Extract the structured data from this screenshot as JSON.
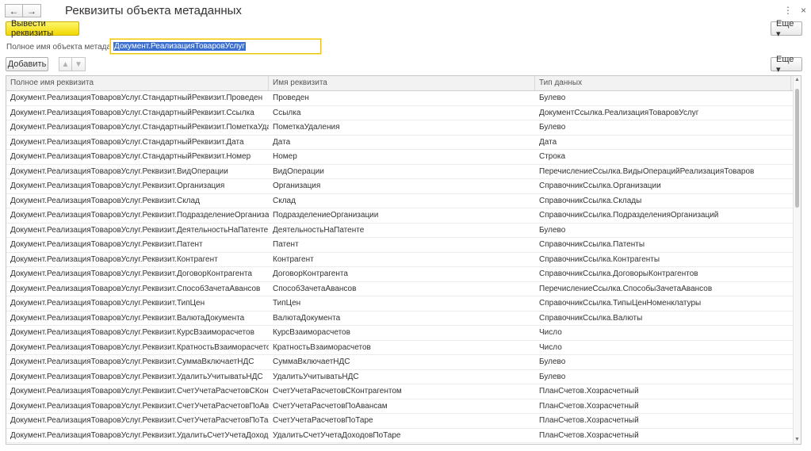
{
  "window": {
    "title": "Реквизиты объекта метаданных",
    "back_icon": "←",
    "forward_icon": "→",
    "more_icon": "⋮",
    "close_icon": "×"
  },
  "toolbar": {
    "print_button": "Вывести реквизиты",
    "more_button": "Еще ▾"
  },
  "field": {
    "label": "Полное имя объекта метаданных:",
    "value": "Документ.РеализацияТоваровУслуг"
  },
  "table_toolbar": {
    "add_button": "Добавить",
    "up_icon": "▲",
    "down_icon": "▼",
    "more_button": "Еще ▾"
  },
  "table": {
    "columns": [
      "Полное имя реквизита",
      "Имя реквизита",
      "Тип данных"
    ],
    "rows": [
      [
        "Документ.РеализацияТоваровУслуг.СтандартныйРеквизит.Проведен",
        "Проведен",
        "Булево"
      ],
      [
        "Документ.РеализацияТоваровУслуг.СтандартныйРеквизит.Ссылка",
        "Ссылка",
        "ДокументСсылка.РеализацияТоваровУслуг"
      ],
      [
        "Документ.РеализацияТоваровУслуг.СтандартныйРеквизит.ПометкаУдаления",
        "ПометкаУдаления",
        "Булево"
      ],
      [
        "Документ.РеализацияТоваровУслуг.СтандартныйРеквизит.Дата",
        "Дата",
        "Дата"
      ],
      [
        "Документ.РеализацияТоваровУслуг.СтандартныйРеквизит.Номер",
        "Номер",
        "Строка"
      ],
      [
        "Документ.РеализацияТоваровУслуг.Реквизит.ВидОперации",
        "ВидОперации",
        "ПеречислениеСсылка.ВидыОперацийРеализацияТоваров"
      ],
      [
        "Документ.РеализацияТоваровУслуг.Реквизит.Организация",
        "Организация",
        "СправочникСсылка.Организации"
      ],
      [
        "Документ.РеализацияТоваровУслуг.Реквизит.Склад",
        "Склад",
        "СправочникСсылка.Склады"
      ],
      [
        "Документ.РеализацияТоваровУслуг.Реквизит.ПодразделениеОрганизации",
        "ПодразделениеОрганизации",
        "СправочникСсылка.ПодразделенияОрганизаций"
      ],
      [
        "Документ.РеализацияТоваровУслуг.Реквизит.ДеятельностьНаПатенте",
        "ДеятельностьНаПатенте",
        "Булево"
      ],
      [
        "Документ.РеализацияТоваровУслуг.Реквизит.Патент",
        "Патент",
        "СправочникСсылка.Патенты"
      ],
      [
        "Документ.РеализацияТоваровУслуг.Реквизит.Контрагент",
        "Контрагент",
        "СправочникСсылка.Контрагенты"
      ],
      [
        "Документ.РеализацияТоваровУслуг.Реквизит.ДоговорКонтрагента",
        "ДоговорКонтрагента",
        "СправочникСсылка.ДоговорыКонтрагентов"
      ],
      [
        "Документ.РеализацияТоваровУслуг.Реквизит.СпособЗачетаАвансов",
        "СпособЗачетаАвансов",
        "ПеречислениеСсылка.СпособыЗачетаАвансов"
      ],
      [
        "Документ.РеализацияТоваровУслуг.Реквизит.ТипЦен",
        "ТипЦен",
        "СправочникСсылка.ТипыЦенНоменклатуры"
      ],
      [
        "Документ.РеализацияТоваровУслуг.Реквизит.ВалютаДокумента",
        "ВалютаДокумента",
        "СправочникСсылка.Валюты"
      ],
      [
        "Документ.РеализацияТоваровУслуг.Реквизит.КурсВзаиморасчетов",
        "КурсВзаиморасчетов",
        "Число"
      ],
      [
        "Документ.РеализацияТоваровУслуг.Реквизит.КратностьВзаиморасчетов",
        "КратностьВзаиморасчетов",
        "Число"
      ],
      [
        "Документ.РеализацияТоваровУслуг.Реквизит.СуммаВключаетНДС",
        "СуммаВключаетНДС",
        "Булево"
      ],
      [
        "Документ.РеализацияТоваровУслуг.Реквизит.УдалитьУчитыватьНДС",
        "УдалитьУчитыватьНДС",
        "Булево"
      ],
      [
        "Документ.РеализацияТоваровУслуг.Реквизит.СчетУчетаРасчетовСКонтрагентом",
        "СчетУчетаРасчетовСКонтрагентом",
        "ПланСчетов.Хозрасчетный"
      ],
      [
        "Документ.РеализацияТоваровУслуг.Реквизит.СчетУчетаРасчетовПоАвансам",
        "СчетУчетаРасчетовПоАвансам",
        "ПланСчетов.Хозрасчетный"
      ],
      [
        "Документ.РеализацияТоваровУслуг.Реквизит.СчетУчетаРасчетовПоТаре",
        "СчетУчетаРасчетовПоТаре",
        "ПланСчетов.Хозрасчетный"
      ],
      [
        "Документ.РеализацияТоваровУслуг.Реквизит.УдалитьСчетУчетаДоходовПоТаре",
        "УдалитьСчетУчетаДоходовПоТаре",
        "ПланСчетов.Хозрасчетный"
      ]
    ]
  },
  "scrollbar": {
    "up_icon": "▲",
    "down_icon": "▼"
  }
}
